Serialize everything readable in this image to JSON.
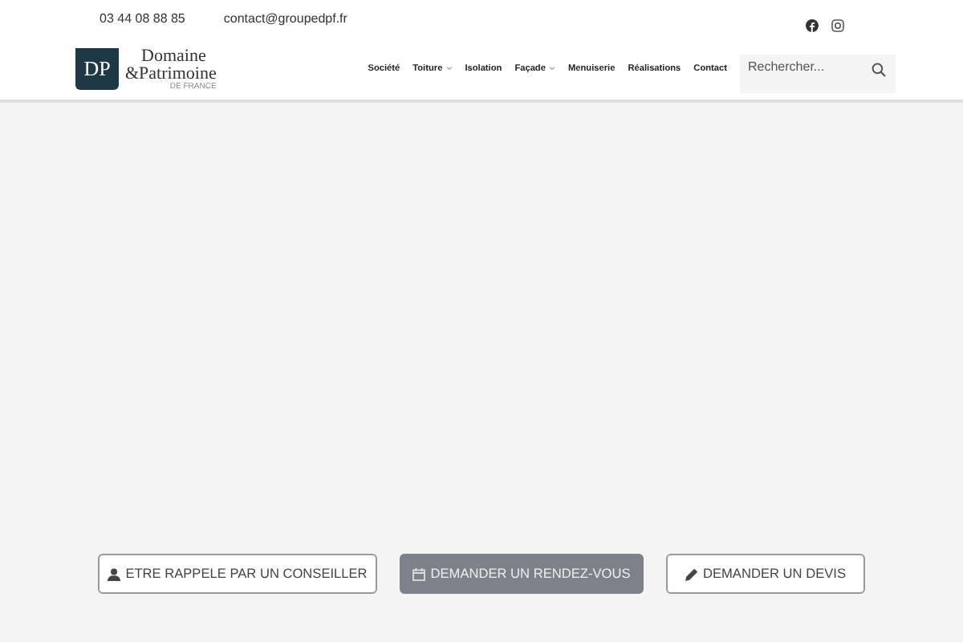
{
  "topbar": {
    "phone": "03 44 08 88 85",
    "email": "contact@groupedpf.fr"
  },
  "logo": {
    "monogram": "DP",
    "line_1": "Domaine",
    "line_2": "&Patrimoine",
    "tagline": "DE FRANCE"
  },
  "nav": [
    {
      "label": "Société",
      "dropdown": false
    },
    {
      "label": "Toiture",
      "dropdown": true
    },
    {
      "label": "Isolation",
      "dropdown": false
    },
    {
      "label": "Façade",
      "dropdown": true
    },
    {
      "label": "Menuiserie",
      "dropdown": false
    },
    {
      "label": "Réalisations",
      "dropdown": false
    },
    {
      "label": "Contact",
      "dropdown": false
    }
  ],
  "search": {
    "placeholder": "Rechercher..."
  },
  "actions": [
    {
      "label": "ETRE RAPPELE PAR UN CONSEILLER",
      "kind": "outline"
    },
    {
      "label": "DEMANDER UN RENDEZ-VOUS",
      "kind": "filled"
    },
    {
      "label": "DEMANDER UN DEVIS",
      "kind": "outline"
    }
  ]
}
